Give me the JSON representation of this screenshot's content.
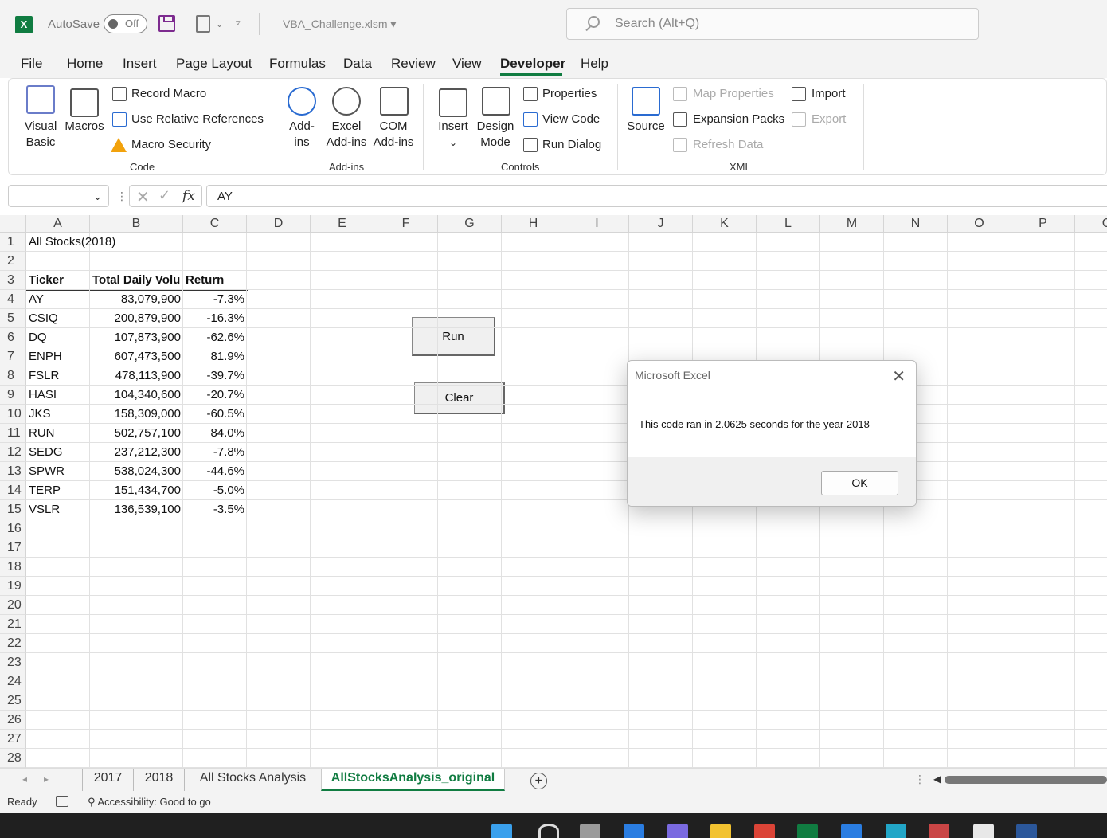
{
  "titlebar": {
    "autosave_label": "AutoSave",
    "autosave_state": "Off",
    "filename": "VBA_Challenge.xlsm",
    "search_placeholder": "Search (Alt+Q)"
  },
  "menu": [
    "File",
    "Home",
    "Insert",
    "Page Layout",
    "Formulas",
    "Data",
    "Review",
    "View",
    "Developer",
    "Help"
  ],
  "active_menu": "Developer",
  "ribbon": {
    "code": {
      "visual_basic": [
        "Visual",
        "Basic"
      ],
      "macros": "Macros",
      "record_macro": "Record Macro",
      "use_relative": "Use Relative References",
      "macro_security": "Macro Security",
      "label": "Code"
    },
    "addins": {
      "addins": [
        "Add-",
        "ins"
      ],
      "excel_addins": [
        "Excel",
        "Add-ins"
      ],
      "com_addins": [
        "COM",
        "Add-ins"
      ],
      "label": "Add-ins"
    },
    "controls": {
      "insert": "Insert",
      "design_mode": [
        "Design",
        "Mode"
      ],
      "properties": "Properties",
      "view_code": "View Code",
      "run_dialog": "Run Dialog",
      "label": "Controls"
    },
    "xml": {
      "source": "Source",
      "map_properties": "Map Properties",
      "expansion_packs": "Expansion Packs",
      "refresh_data": "Refresh Data",
      "import": "Import",
      "export": "Export",
      "label": "XML"
    }
  },
  "formula_bar": {
    "name_box": "",
    "fx": "fx",
    "value": "AY"
  },
  "columns": [
    "A",
    "B",
    "C",
    "D",
    "E",
    "F",
    "G",
    "H",
    "I",
    "J",
    "K",
    "L",
    "M",
    "N",
    "O",
    "P",
    "C"
  ],
  "rows": [
    "1",
    "2",
    "3",
    "4",
    "5",
    "6",
    "7",
    "8",
    "9",
    "10",
    "11",
    "12",
    "13",
    "14",
    "15",
    "16",
    "17",
    "18",
    "19",
    "20",
    "21",
    "22",
    "23",
    "24",
    "25",
    "26",
    "27",
    "28"
  ],
  "sheet": {
    "title": "All Stocks(2018)",
    "headers": [
      "Ticker",
      "Total Daily Volu",
      "Return"
    ],
    "data": [
      [
        "AY",
        "83,079,900",
        "-7.3%"
      ],
      [
        "CSIQ",
        "200,879,900",
        "-16.3%"
      ],
      [
        "DQ",
        "107,873,900",
        "-62.6%"
      ],
      [
        "ENPH",
        "607,473,500",
        "81.9%"
      ],
      [
        "FSLR",
        "478,113,900",
        "-39.7%"
      ],
      [
        "HASI",
        "104,340,600",
        "-20.7%"
      ],
      [
        "JKS",
        "158,309,000",
        "-60.5%"
      ],
      [
        "RUN",
        "502,757,100",
        "84.0%"
      ],
      [
        "SEDG",
        "237,212,300",
        "-7.8%"
      ],
      [
        "SPWR",
        "538,024,300",
        "-44.6%"
      ],
      [
        "TERP",
        "151,434,700",
        "-5.0%"
      ],
      [
        "VSLR",
        "136,539,100",
        "-3.5%"
      ]
    ]
  },
  "buttons": {
    "run": "Run",
    "clear": "Clear"
  },
  "dialog": {
    "title": "Microsoft Excel",
    "message": "This code ran in 2.0625 seconds for the year 2018",
    "ok": "OK"
  },
  "tabs": [
    "2017",
    "2018",
    "All Stocks Analysis",
    "AllStocksAnalysis_original"
  ],
  "active_tab": "AllStocksAnalysis_original",
  "status": {
    "ready": "Ready",
    "accessibility": "Accessibility: Good to go"
  },
  "colors": {
    "excel_green": "#107c41",
    "warning": "#f2a20c",
    "taskbar": "#202020"
  }
}
